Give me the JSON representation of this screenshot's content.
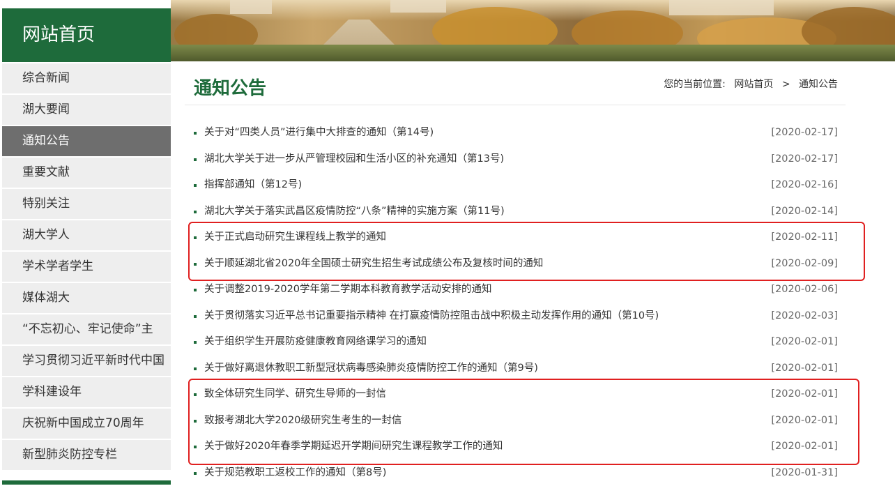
{
  "sidebar": {
    "title": "网站首页",
    "items": [
      {
        "label": "综合新闻"
      },
      {
        "label": "湖大要闻"
      },
      {
        "label": "通知公告",
        "active": true
      },
      {
        "label": "重要文献"
      },
      {
        "label": "特别关注"
      },
      {
        "label": "湖大学人"
      },
      {
        "label": "学术学者学生"
      },
      {
        "label": "媒体湖大"
      },
      {
        "label": "“不忘初心、牢记使命”主"
      },
      {
        "label": "学习贯彻习近平新时代中国"
      },
      {
        "label": "学科建设年"
      },
      {
        "label": "庆祝新中国成立70周年"
      },
      {
        "label": "新型肺炎防控专栏"
      }
    ]
  },
  "main": {
    "title": "通知公告",
    "breadcrumb": {
      "prefix": "您的当前位置:",
      "home": "网站首页",
      "separator": ">",
      "current": "通知公告"
    },
    "items": [
      {
        "text": "关于对“四类人员”进行集中大排查的通知（第14号)",
        "date": "[2020-02-17]"
      },
      {
        "text": "湖北大学关于进一步从严管理校园和生活小区的补充通知（第13号)",
        "date": "[2020-02-17]"
      },
      {
        "text": "指挥部通知（第12号)",
        "date": "[2020-02-16]"
      },
      {
        "text": "湖北大学关于落实武昌区疫情防控“八条”精神的实施方案（第11号)",
        "date": "[2020-02-14]"
      },
      {
        "text": "关于正式启动研究生课程线上教学的通知",
        "date": "[2020-02-11]"
      },
      {
        "text": "关于顺延湖北省2020年全国硕士研究生招生考试成绩公布及复核时间的通知",
        "date": "[2020-02-09]"
      },
      {
        "text": "关于调整2019-2020学年第二学期本科教育教学活动安排的通知",
        "date": "[2020-02-06]"
      },
      {
        "text": "关于贯彻落实习近平总书记重要指示精神 在打赢疫情防控阻击战中积极主动发挥作用的通知（第10号)",
        "date": "[2020-02-03]"
      },
      {
        "text": "关于组织学生开展防疫健康教育网络课学习的通知",
        "date": "[2020-02-01]"
      },
      {
        "text": "关于做好离退休教职工新型冠状病毒感染肺炎疫情防控工作的通知（第9号)",
        "date": "[2020-02-01]"
      },
      {
        "text": "致全体研究生同学、研究生导师的一封信",
        "date": "[2020-02-01]"
      },
      {
        "text": "致报考湖北大学2020级研究生考生的一封信",
        "date": "[2020-02-01]"
      },
      {
        "text": "关于做好2020年春季学期延迟开学期间研究生课程教学工作的通知",
        "date": "[2020-02-01]"
      },
      {
        "text": "关于规范教职工返校工作的通知（第8号)",
        "date": "[2020-01-31]"
      }
    ]
  },
  "colors": {
    "brand_green": "#1e6b3b",
    "active_gray": "#6e6e6e",
    "highlight_red": "#e02020"
  }
}
